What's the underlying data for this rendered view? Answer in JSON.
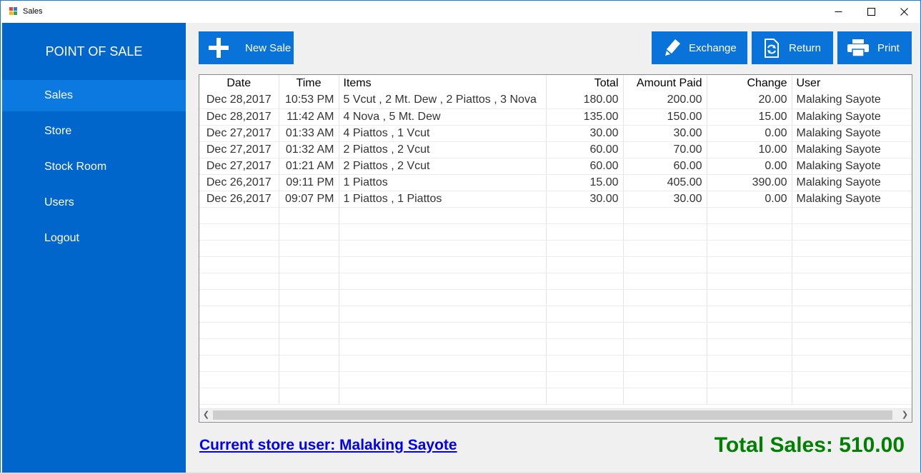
{
  "window": {
    "title": "Sales"
  },
  "sidebar": {
    "brand": "POINT OF SALE",
    "items": [
      {
        "label": "Sales",
        "active": true
      },
      {
        "label": "Store"
      },
      {
        "label": "Stock Room"
      },
      {
        "label": "Users"
      },
      {
        "label": "Logout"
      }
    ]
  },
  "toolbar": {
    "new_sale": "New Sale",
    "exchange": "Exchange",
    "return": "Return",
    "print": "Print"
  },
  "table": {
    "columns": [
      "Date",
      "Time",
      "Items",
      "Total",
      "Amount Paid",
      "Change",
      "User"
    ],
    "rows": [
      [
        "Dec 28,2017",
        "10:53 PM",
        "5 Vcut , 2 Mt. Dew , 2 Piattos , 3 Nova",
        "180.00",
        "200.00",
        "20.00",
        "Malaking Sayote"
      ],
      [
        "Dec 28,2017",
        "11:42 AM",
        "4 Nova , 5 Mt. Dew",
        "135.00",
        "150.00",
        "15.00",
        "Malaking Sayote"
      ],
      [
        "Dec 27,2017",
        "01:33 AM",
        "4 Piattos , 1 Vcut",
        "30.00",
        "30.00",
        "0.00",
        "Malaking Sayote"
      ],
      [
        "Dec 27,2017",
        "01:32 AM",
        "2 Piattos , 2 Vcut",
        "60.00",
        "70.00",
        "10.00",
        "Malaking Sayote"
      ],
      [
        "Dec 27,2017",
        "01:21 AM",
        "2 Piattos , 2 Vcut",
        "60.00",
        "60.00",
        "0.00",
        "Malaking Sayote"
      ],
      [
        "Dec 26,2017",
        "09:11 PM",
        "1 Piattos",
        "15.00",
        "405.00",
        "390.00",
        "Malaking Sayote"
      ],
      [
        "Dec 26,2017",
        "09:07 PM",
        "1 Piattos , 1 Piattos",
        "30.00",
        "30.00",
        "0.00",
        "Malaking Sayote"
      ]
    ]
  },
  "footer": {
    "current_user": "Current store user: Malaking Sayote",
    "total_sales": "Total Sales: 510.00"
  },
  "colors": {
    "sidebar": "#0066cc",
    "sidebar_active": "#0b79e0",
    "button": "#0a73d9",
    "total_text": "#008000",
    "link_text": "#0000ee"
  }
}
